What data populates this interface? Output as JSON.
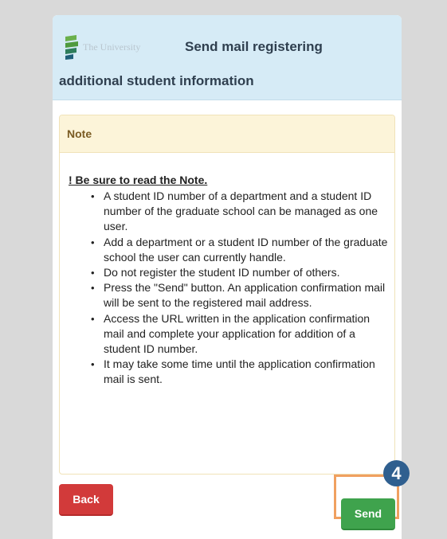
{
  "header": {
    "logo_text": "The University",
    "title_line1": "Send mail registering",
    "title_line2": "additional student information"
  },
  "note": {
    "title": "Note",
    "warning": "! Be sure to read the Note.",
    "items": [
      "A student ID number of a department and a student ID number of the graduate school can be managed as one user.",
      "Add a department or a student ID number of the graduate school the user can currently handle.",
      "Do not register the student ID number of others.",
      "Press the \"Send\" button. An application confirmation mail will be sent to the registered mail address.",
      "Access the URL written in the application confirmation mail and complete your application for addition of a student ID number.",
      "It may take some time until the application confirmation mail is sent."
    ]
  },
  "buttons": {
    "back_label": "Back",
    "send_label": "Send"
  },
  "callout": {
    "step_number": "4"
  },
  "colors": {
    "header_bg": "#d6ebf6",
    "note_head_bg": "#fcf4d9",
    "back_button": "#d23a3a",
    "send_button": "#3fa34d",
    "highlight_frame": "#f0a060",
    "step_badge": "#2f5f8f"
  }
}
